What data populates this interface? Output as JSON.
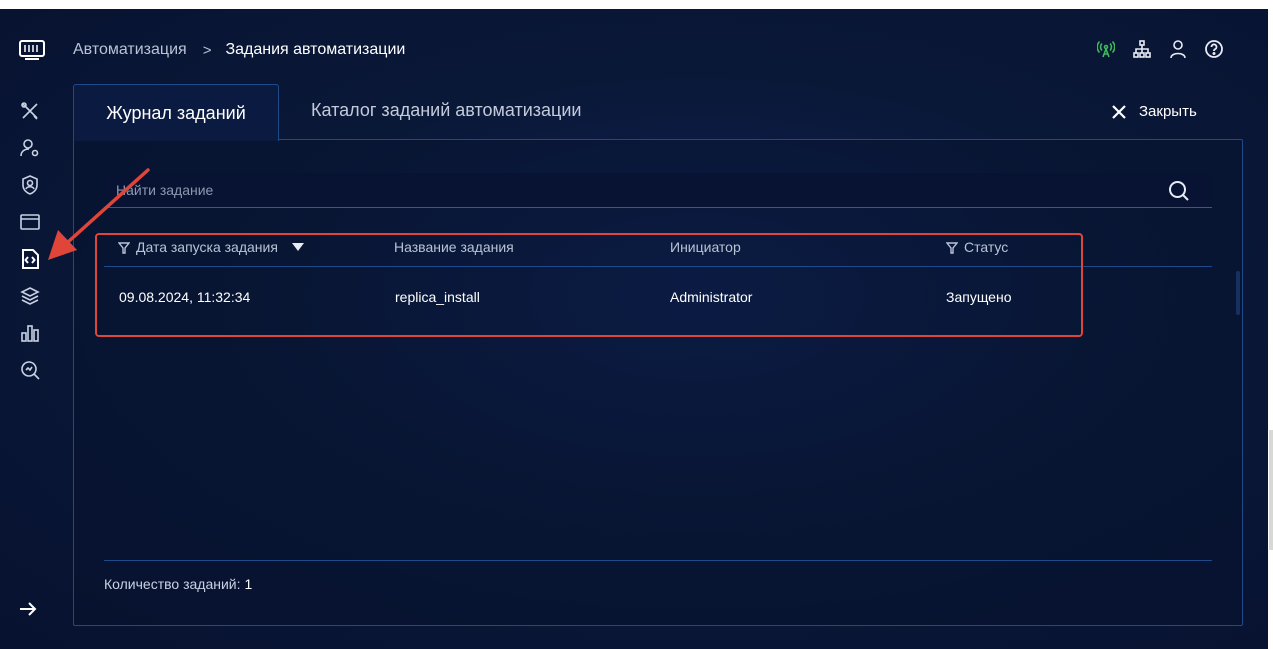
{
  "breadcrumb": {
    "parent": "Автоматизация",
    "separator": ">",
    "current": "Задания автоматизации"
  },
  "tabs": {
    "active": "Журнал заданий",
    "inactive": "Каталог заданий автоматизации"
  },
  "close_label": "Закрыть",
  "search": {
    "placeholder": "Найти задание"
  },
  "table": {
    "headers": [
      "Дата запуска задания",
      "Название задания",
      "Инициатор",
      "Статус"
    ],
    "rows": [
      {
        "date": "09.08.2024, 11:32:34",
        "name": "replica_install",
        "initiator": "Administrator",
        "status": "Запущено"
      }
    ]
  },
  "footer": {
    "label": "Количество заданий:",
    "count": "1"
  },
  "sidebar": {
    "icons": [
      "tools-icon",
      "user-settings-icon",
      "user-shield-icon",
      "window-icon",
      "code-file-icon",
      "layers-icon",
      "bar-chart-icon",
      "search-analytics-icon"
    ],
    "active": "code-file-icon"
  },
  "top_icons": [
    "antenna-icon",
    "network-icon",
    "user-icon",
    "help-icon"
  ],
  "colors": {
    "background": "#0a1838",
    "accent_border": "#1f4a8a",
    "highlight": "#e0453a",
    "antenna": "#3dbb5a"
  }
}
